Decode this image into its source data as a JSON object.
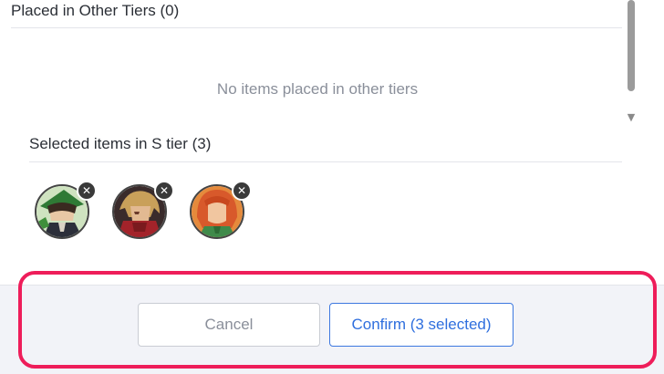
{
  "sections": {
    "other_tiers": {
      "title": "Placed in Other Tiers (0)",
      "empty_message": "No items placed in other tiers"
    },
    "selected": {
      "title": "Selected items in S tier (3)",
      "items": [
        {
          "name": "character-green-hat",
          "remove_icon": "close-icon",
          "remove_glyph": "✕"
        },
        {
          "name": "character-blonde-red",
          "remove_icon": "close-icon",
          "remove_glyph": "✕"
        },
        {
          "name": "character-red-hair",
          "remove_icon": "close-icon",
          "remove_glyph": "✕"
        }
      ]
    }
  },
  "scrollbar": {
    "down_arrow": "▼"
  },
  "footer": {
    "cancel_label": "Cancel",
    "confirm_label": "Confirm (3 selected)"
  },
  "colors": {
    "highlight": "#ee1d5a",
    "confirm_accent": "#2f6fde",
    "footer_bg": "#f2f3f8"
  }
}
